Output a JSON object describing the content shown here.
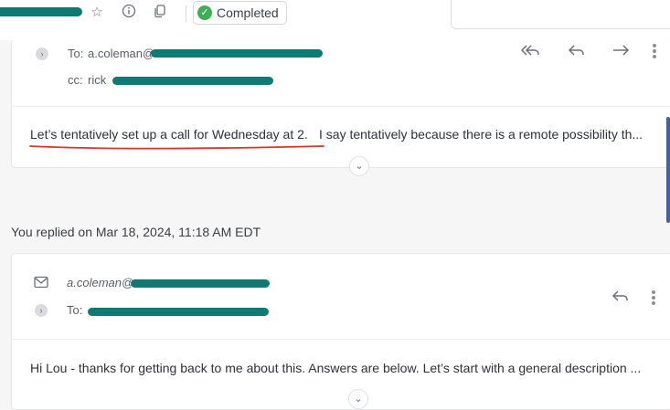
{
  "status": {
    "label": "Completed",
    "color": "#3fae55"
  },
  "icons": {
    "star": "star-icon",
    "info": "info-icon",
    "copy": "copy-icon",
    "more": "more-vertical-icon"
  },
  "message1": {
    "to_label": "To:",
    "to_visible": "a.coleman@",
    "cc_label": "cc:",
    "cc_visible": "rick",
    "body_highlight": "Let’s tentatively set up a call for Wednesday at 2.",
    "body_rest": "  I say tentatively because there is a remote possibility th..."
  },
  "reply_note": "You replied on Mar 18, 2024, 11:18 AM EDT",
  "message2": {
    "from_visible": "a.coleman@",
    "to_label": "To:",
    "body": "Hi Lou - thanks for getting back to me about this. Answers are below. Let’s start with a general description ..."
  },
  "colors": {
    "redaction": "#0f7a74",
    "underline": "#d9352b"
  }
}
